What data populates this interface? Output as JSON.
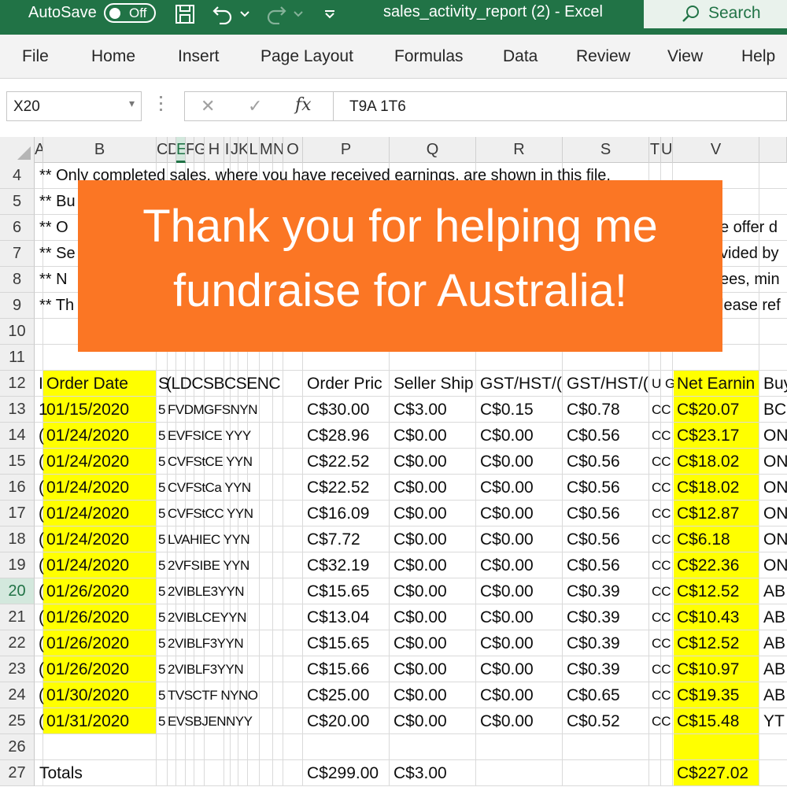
{
  "titlebar": {
    "autosave_label": "AutoSave",
    "autosave_state": "Off",
    "document_title": "sales_activity_report (2)  -  Excel",
    "search_label": "Search",
    "background_color": "#217346"
  },
  "ribbon": {
    "tabs": [
      "File",
      "Home",
      "Insert",
      "Page Layout",
      "Formulas",
      "Data",
      "Review",
      "View",
      "Help"
    ]
  },
  "formula_bar": {
    "name_box": "X20",
    "cancel_symbol": "✕",
    "enter_symbol": "✓",
    "fx_label": "fx",
    "content": "T9A 1T6"
  },
  "sheet": {
    "columns": [
      "A",
      "B",
      "C",
      "D",
      "E",
      "F",
      "G",
      "H",
      "I",
      "J",
      "K",
      "L",
      "M",
      "N",
      "O",
      "P",
      "Q",
      "R",
      "S",
      "T",
      "U",
      "V"
    ],
    "selected_column": "E",
    "selected_row": "20",
    "row_numbers": [
      "4",
      "5",
      "6",
      "7",
      "8",
      "9",
      "10",
      "11",
      "12",
      "13",
      "14",
      "15",
      "16",
      "17",
      "18",
      "19",
      "20",
      "21",
      "22",
      "23",
      "24",
      "25",
      "26",
      "27"
    ],
    "notes": [
      "** Only completed sales, where you have received earnings, are shown in this file.",
      "** Bu",
      "** O",
      "** Se",
      "** N",
      "** Th"
    ],
    "notes_right": [
      "e offer d",
      "vided by",
      "ees, min",
      "lease ref"
    ],
    "header_row": {
      "a": "I",
      "b": "Order Date",
      "c": "S",
      "mid": "(LDCSBCSENC",
      "p": "Order Pric",
      "q": "Seller Ship",
      "r": "GST/HST/(",
      "s": "GST/HST/(",
      "tu": "U G",
      "v": "Net Earnin",
      "w": "Buy"
    },
    "rows": [
      {
        "a": "1",
        "b": "01/15/2020",
        "c": "5",
        "mid": "FVDMGFSNYN",
        "p": "C$30.00",
        "q": "C$3.00",
        "r": "C$0.15",
        "s": "C$0.78",
        "tu": "CC",
        "v": "C$20.07",
        "w": "BC"
      },
      {
        "a": "(",
        "b": "01/24/2020",
        "c": "5",
        "mid": "EVFSICE YYY",
        "p": "C$28.96",
        "q": "C$0.00",
        "r": "C$0.00",
        "s": "C$0.56",
        "tu": "CC",
        "v": "C$23.17",
        "w": "ON"
      },
      {
        "a": "(",
        "b": "01/24/2020",
        "c": "5",
        "mid": "CVFStCE YYN",
        "p": "C$22.52",
        "q": "C$0.00",
        "r": "C$0.00",
        "s": "C$0.56",
        "tu": "CC",
        "v": "C$18.02",
        "w": "ON"
      },
      {
        "a": "(",
        "b": "01/24/2020",
        "c": "5",
        "mid": "CVFStCa YYN",
        "p": "C$22.52",
        "q": "C$0.00",
        "r": "C$0.00",
        "s": "C$0.56",
        "tu": "CC",
        "v": "C$18.02",
        "w": "ON"
      },
      {
        "a": "(",
        "b": "01/24/2020",
        "c": "5",
        "mid": "CVFStCC YYN",
        "p": "C$16.09",
        "q": "C$0.00",
        "r": "C$0.00",
        "s": "C$0.56",
        "tu": "CC",
        "v": "C$12.87",
        "w": "ON"
      },
      {
        "a": "(",
        "b": "01/24/2020",
        "c": "5",
        "mid": "LVAHIEC YYN",
        "p": "C$7.72",
        "q": "C$0.00",
        "r": "C$0.00",
        "s": "C$0.56",
        "tu": "CC",
        "v": "C$6.18",
        "w": "ON"
      },
      {
        "a": "(",
        "b": "01/24/2020",
        "c": "5",
        "mid": "2VFSIBE YYN",
        "p": "C$32.19",
        "q": "C$0.00",
        "r": "C$0.00",
        "s": "C$0.56",
        "tu": "CC",
        "v": "C$22.36",
        "w": "ON"
      },
      {
        "a": "(",
        "b": "01/26/2020",
        "c": "5",
        "mid": "2VIBLE3YYN",
        "p": "C$15.65",
        "q": "C$0.00",
        "r": "C$0.00",
        "s": "C$0.39",
        "tu": "CC",
        "v": "C$12.52",
        "w": "AB"
      },
      {
        "a": "(",
        "b": "01/26/2020",
        "c": "5",
        "mid": "2VIBLCEYYN",
        "p": "C$13.04",
        "q": "C$0.00",
        "r": "C$0.00",
        "s": "C$0.39",
        "tu": "CC",
        "v": "C$10.43",
        "w": "AB"
      },
      {
        "a": "(",
        "b": "01/26/2020",
        "c": "5",
        "mid": "2VIBLF3YYN",
        "p": "C$15.65",
        "q": "C$0.00",
        "r": "C$0.00",
        "s": "C$0.39",
        "tu": "CC",
        "v": "C$12.52",
        "w": "AB"
      },
      {
        "a": "(",
        "b": "01/26/2020",
        "c": "5",
        "mid": "2VIBLF3YYN",
        "p": "C$15.66",
        "q": "C$0.00",
        "r": "C$0.00",
        "s": "C$0.39",
        "tu": "CC",
        "v": "C$10.97",
        "w": "AB"
      },
      {
        "a": "(",
        "b": "01/30/2020",
        "c": "5",
        "mid": "TVSCTF NYNO",
        "p": "C$25.00",
        "q": "C$0.00",
        "r": "C$0.00",
        "s": "C$0.65",
        "tu": "CC",
        "v": "C$19.35",
        "w": "AB"
      },
      {
        "a": "(",
        "b": "01/31/2020",
        "c": "5",
        "mid": "EVSBJENNYY",
        "p": "C$20.00",
        "q": "C$0.00",
        "r": "C$0.00",
        "s": "C$0.52",
        "tu": "CC",
        "v": "C$15.48",
        "w": "YT"
      }
    ],
    "totals": {
      "label": "Totals",
      "order_price": "C$299.00",
      "seller_ship": "C$3.00",
      "net_earnings": "C$227.02"
    },
    "highlight_color": "#ffff00"
  },
  "banner": {
    "line1": "Thank you for helping me",
    "line2": "fundraise for Australia!",
    "color": "#fb7624"
  }
}
